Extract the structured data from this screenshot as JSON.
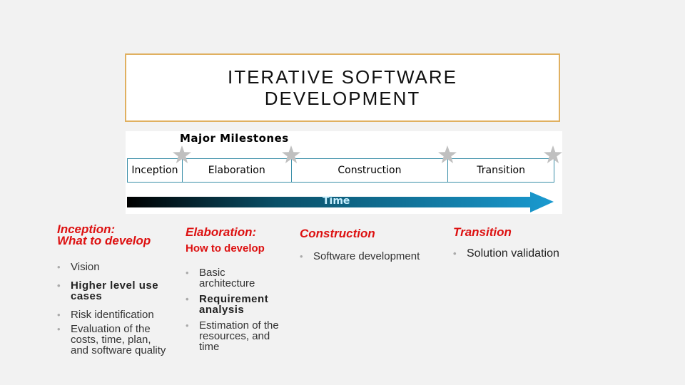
{
  "title": {
    "line1": "ITERATIVE SOFTWARE",
    "line2": "DEVELOPMENT"
  },
  "diagram": {
    "heading": "Major  Milestones",
    "phases": [
      "Inception",
      "Elaboration",
      "Construction",
      "Transition"
    ],
    "milestone_icon": "star-icon",
    "arrow_label": "Time",
    "colors": {
      "border": "#3a8ea8",
      "star": "#c0c0c0",
      "arrow_start": "#000000",
      "arrow_end": "#1a9ad0"
    }
  },
  "columns": [
    {
      "heading": "Inception:\nWhat to develop",
      "heading_line1": "Inception:",
      "heading_line2": "What to develop",
      "items": [
        {
          "text": "Vision",
          "bold": false
        },
        {
          "text": "Higher level use cases",
          "bold": true
        },
        {
          "text": "Risk identification",
          "bold": false
        },
        {
          "text": "Evaluation of the costs, time, plan, and software quality",
          "bold": false
        }
      ]
    },
    {
      "heading": "Elaboration:",
      "subheading": "How to develop",
      "items": [
        {
          "text": "Basic architecture",
          "bold": false
        },
        {
          "text": "Requirement analysis",
          "bold": true
        },
        {
          "text": "Estimation of the resources, and time",
          "bold": false
        }
      ]
    },
    {
      "heading": "Construction",
      "items": [
        {
          "text": "Software development",
          "bold": false
        }
      ]
    },
    {
      "heading": "Transition",
      "items": [
        {
          "text": "Solution validation",
          "bold": true
        }
      ]
    }
  ],
  "colors": {
    "accent_red": "#dd1111",
    "title_border": "#e0b060",
    "background": "#f2f2f2"
  }
}
